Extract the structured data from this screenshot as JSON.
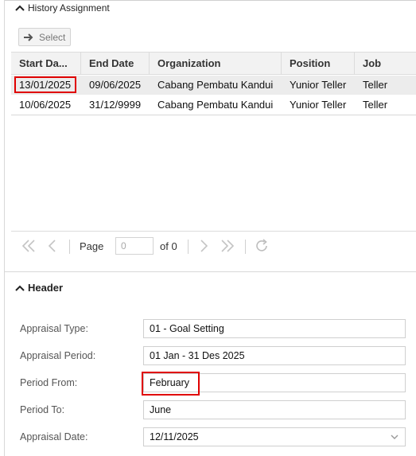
{
  "history": {
    "title": "History Assignment",
    "select_label": "Select",
    "columns": [
      "Start Da...",
      "End Date",
      "Organization",
      "Position",
      "Job"
    ],
    "rows": [
      [
        "13/01/2025",
        "09/06/2025",
        "Cabang Pembatu Kandui",
        "Yunior Teller",
        "Teller"
      ],
      [
        "10/06/2025",
        "31/12/9999",
        "Cabang Pembatu Kandui",
        "Yunior Teller",
        "Teller"
      ]
    ],
    "pager": {
      "page_label": "Page",
      "page_value": "0",
      "of_label": "of 0"
    }
  },
  "header": {
    "title": "Header",
    "fields": [
      {
        "label": "Appraisal Type:",
        "value": "01 - Goal Setting"
      },
      {
        "label": "Appraisal Period:",
        "value": "01 Jan - 31 Des 2025"
      },
      {
        "label": "Period From:",
        "value": "February"
      },
      {
        "label": "Period To:",
        "value": "June"
      },
      {
        "label": "Appraisal Date:",
        "value": "12/11/2025"
      }
    ]
  },
  "colors": {
    "highlight": "#e00000",
    "header_bg": "#f2f2f2",
    "selected_row_bg": "#ececec"
  }
}
